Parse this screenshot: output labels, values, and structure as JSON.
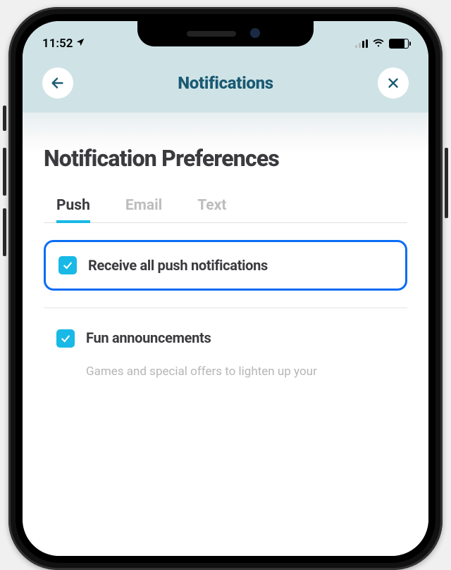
{
  "status": {
    "time": "11:52"
  },
  "header": {
    "title": "Notifications"
  },
  "page": {
    "title": "Notification Preferences"
  },
  "tabs": {
    "items": [
      {
        "label": "Push",
        "active": true
      },
      {
        "label": "Email",
        "active": false
      },
      {
        "label": "Text",
        "active": false
      }
    ]
  },
  "options": {
    "receive_all": {
      "label": "Receive all push notifications",
      "checked": true
    },
    "fun": {
      "label": "Fun announcements",
      "description": "Games and special offers to lighten up your",
      "checked": true
    }
  },
  "colors": {
    "accent": "#18b9e6",
    "highlight_border": "#0a6cf5",
    "header_bg": "#cfe3e7",
    "title": "#1a5a72"
  }
}
